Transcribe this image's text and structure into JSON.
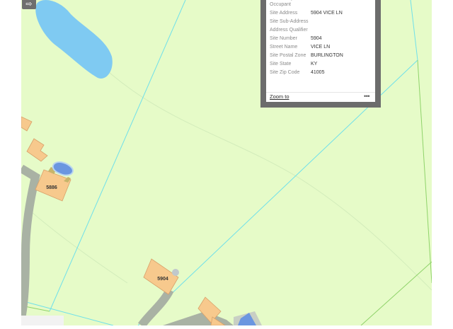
{
  "map": {
    "background_color": "#e6fbc8",
    "water_color": "#7fcaf2",
    "building_color": "#f7c98d",
    "road_color": "#a9b2a4",
    "pool_color": "#6b96e0",
    "parcel_line_color": "#6fe0ea",
    "building_labels": [
      "5886",
      "5904"
    ]
  },
  "toolbar": {
    "expand_icon": "arrow-right-icon"
  },
  "popup": {
    "rows": [
      {
        "key": "Secondary Occupant",
        "value": ""
      },
      {
        "key": "Site Address",
        "value": "5904 VICE LN"
      },
      {
        "key": "Site Sub-Address",
        "value": ""
      },
      {
        "key": "Address Qualifier",
        "value": ""
      },
      {
        "key": "Site Number",
        "value": "5904"
      },
      {
        "key": "Street Name",
        "value": "VICE LN"
      },
      {
        "key": "Site Postal Zone",
        "value": "BURLINGTON"
      },
      {
        "key": "Site State",
        "value": "KY"
      },
      {
        "key": "Site Zip Code",
        "value": "41005"
      }
    ],
    "zoom_label": "Zoom to",
    "more_label": "•••"
  }
}
